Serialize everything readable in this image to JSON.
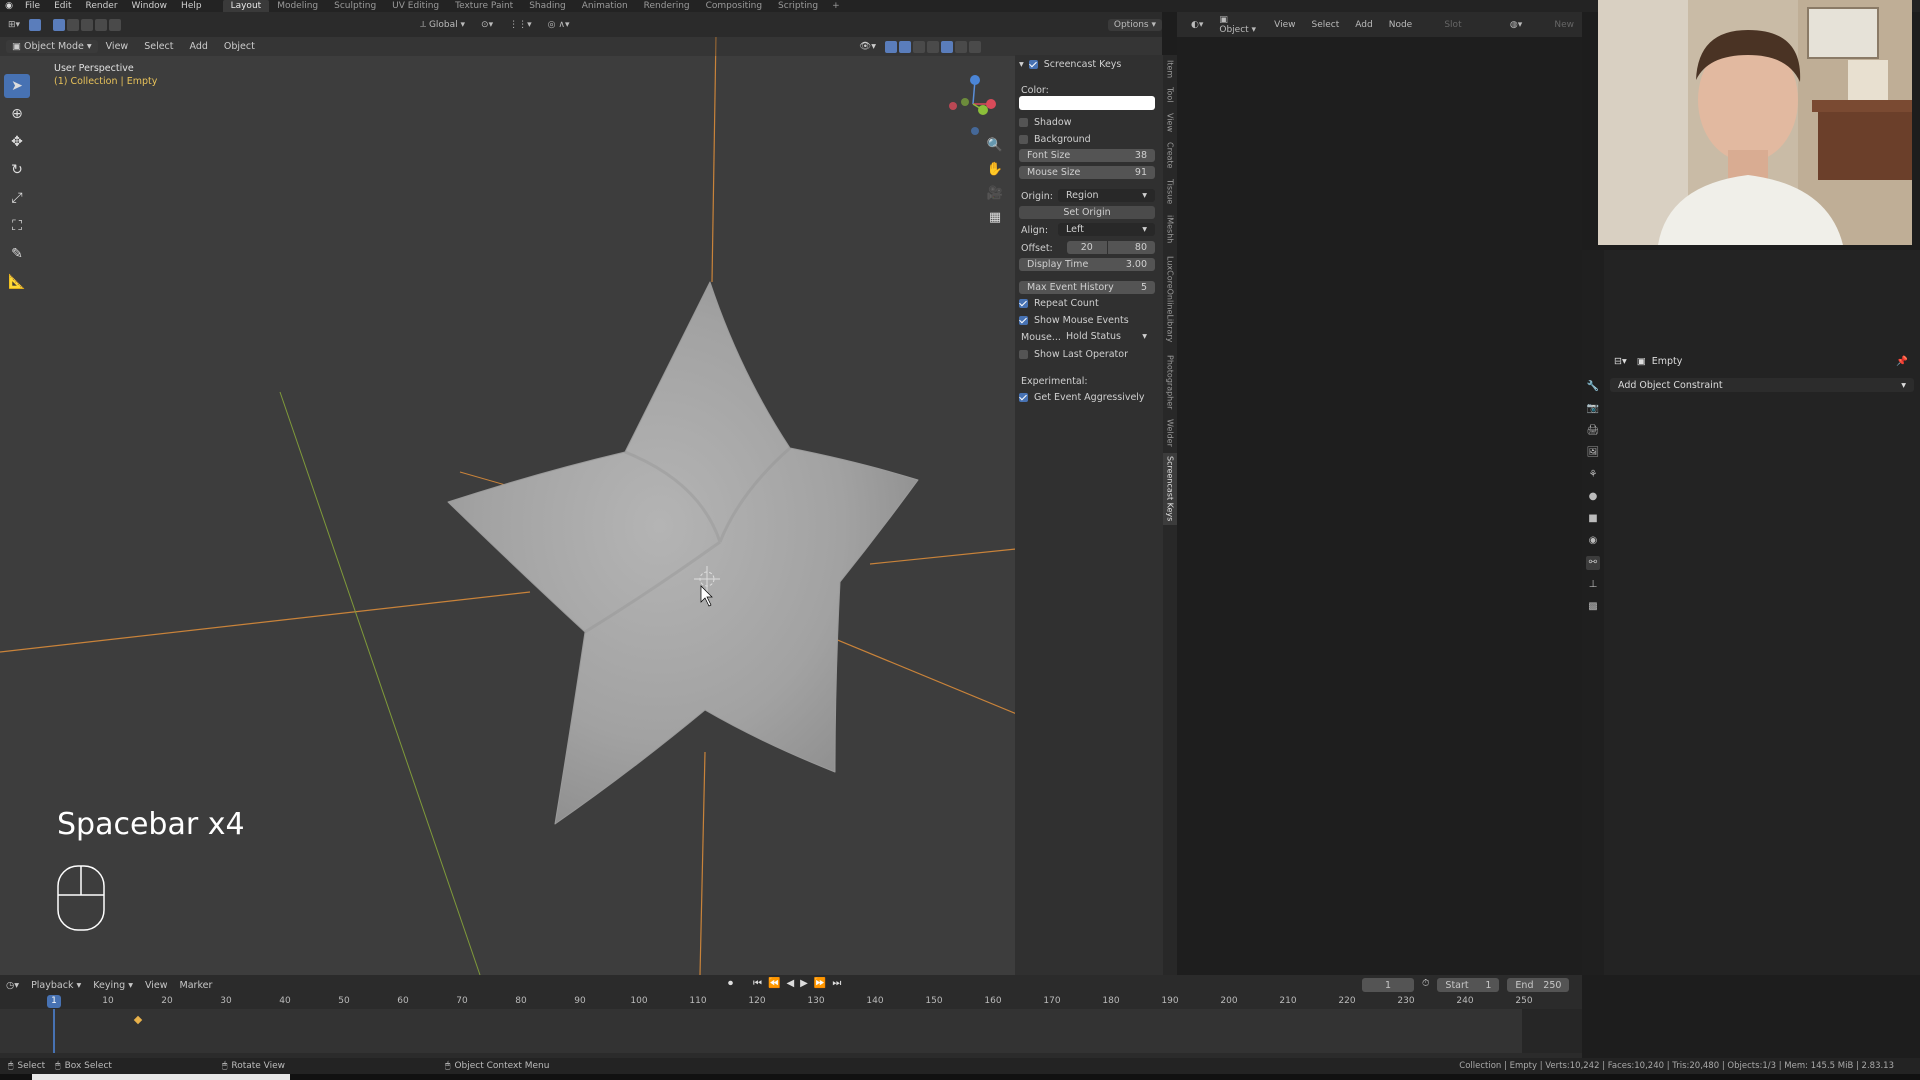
{
  "topbar": {
    "menus": [
      "File",
      "Edit",
      "Render",
      "Window",
      "Help"
    ],
    "workspaces": [
      "Layout",
      "Modeling",
      "Sculpting",
      "UV Editing",
      "Texture Paint",
      "Shading",
      "Animation",
      "Rendering",
      "Compositing",
      "Scripting"
    ],
    "active_workspace": "Layout",
    "add": "+"
  },
  "viewport": {
    "orientation": "Global",
    "options_label": "Options",
    "mode": "Object Mode",
    "menus": [
      "View",
      "Select",
      "Add",
      "Object"
    ],
    "perspective_label": "User Perspective",
    "collection_label": "(1) Collection | Empty",
    "screencast_text": "Spacebar x4"
  },
  "npanel": {
    "title": "Screencast Keys",
    "color_label": "Color:",
    "shadow": "Shadow",
    "background": "Background",
    "font_size_label": "Font Size",
    "font_size": "38",
    "mouse_size_label": "Mouse Size",
    "mouse_size": "91",
    "origin_label": "Origin:",
    "origin_value": "Region",
    "set_origin": "Set Origin",
    "align_label": "Align:",
    "align_value": "Left",
    "offset_label": "Offset:",
    "offset_x": "20",
    "offset_y": "80",
    "display_time_label": "Display Time",
    "display_time": "3.00",
    "max_event_label": "Max Event History",
    "max_event": "5",
    "repeat_count": "Repeat Count",
    "show_mouse_events": "Show Mouse Events",
    "mouse_label": "Mouse...",
    "mouse_value": "Hold Status",
    "show_last_operator": "Show Last Operator",
    "experimental": "Experimental:",
    "get_event": "Get Event Aggressively"
  },
  "vtabs": [
    "Item",
    "Tool",
    "View",
    "Create",
    "Tissue",
    "iMeshh",
    "LuxCoreOnlineLibrary",
    "Photographer",
    "Welder",
    "Screencast Keys"
  ],
  "node_editor": {
    "type": "Object",
    "menus": [
      "View",
      "Select",
      "Add",
      "Node"
    ],
    "slot": "Slot",
    "new": "New"
  },
  "props": {
    "object_name": "Empty",
    "add_constraint": "Add Object Constraint"
  },
  "timeline": {
    "menus": [
      "Playback",
      "Keying",
      "View",
      "Marker"
    ],
    "current_frame": "1",
    "start_label": "Start",
    "start": "1",
    "end_label": "End",
    "end": "250",
    "ticks": [
      "10",
      "20",
      "30",
      "40",
      "50",
      "60",
      "70",
      "80",
      "90",
      "100",
      "110",
      "120",
      "130",
      "140",
      "150",
      "160",
      "170",
      "180",
      "190",
      "200",
      "210",
      "220",
      "230",
      "240",
      "250"
    ],
    "playhead": "1"
  },
  "statusbar": {
    "select": "Select",
    "box_select": "Box Select",
    "rotate_view": "Rotate View",
    "context_menu": "Object Context Menu",
    "stats": "Collection | Empty | Verts:10,242 | Faces:10,240 | Tris:20,480 | Objects:1/3 | Mem: 145.5 MiB | 2.83.13"
  },
  "colors": {
    "accent": "#4772b3",
    "viewport_bg": "#3d3d3d",
    "axis_x": "#c9833a",
    "axis_y": "#7f9a3a",
    "keyframe": "#e8b14a"
  }
}
